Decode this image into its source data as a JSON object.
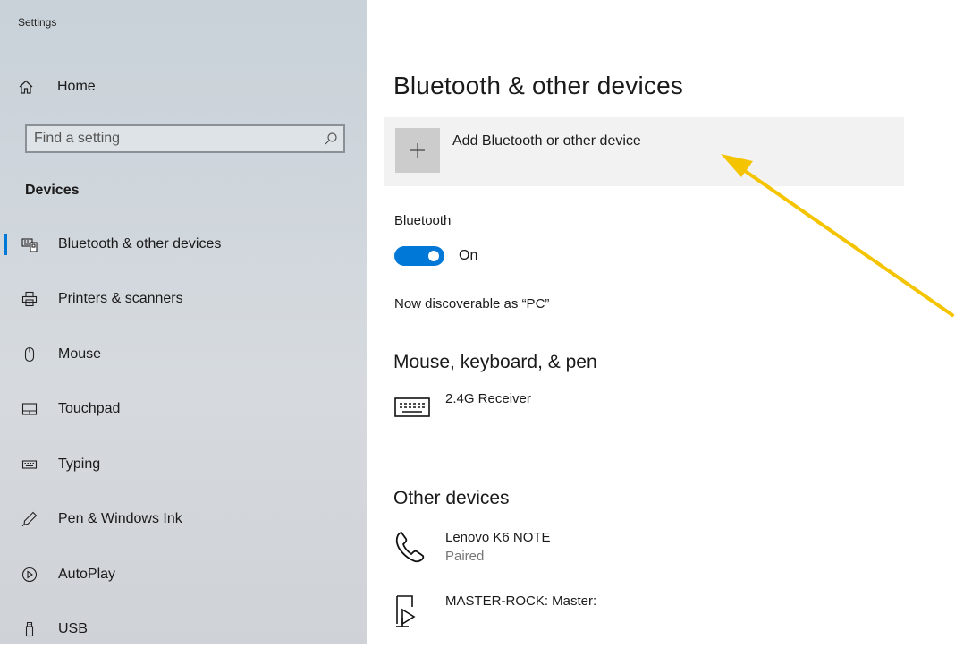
{
  "app": {
    "title": "Settings"
  },
  "sidebar": {
    "home_label": "Home",
    "search": {
      "placeholder": "Find a setting",
      "value": ""
    },
    "section_title": "Devices",
    "items": [
      {
        "label": "Bluetooth & other devices",
        "icon": "bluetooth-devices-icon",
        "active": true
      },
      {
        "label": "Printers & scanners",
        "icon": "printer-icon"
      },
      {
        "label": "Mouse",
        "icon": "mouse-icon"
      },
      {
        "label": "Touchpad",
        "icon": "touchpad-icon"
      },
      {
        "label": "Typing",
        "icon": "keyboard-icon"
      },
      {
        "label": "Pen & Windows Ink",
        "icon": "pen-icon"
      },
      {
        "label": "AutoPlay",
        "icon": "autoplay-icon"
      },
      {
        "label": "USB",
        "icon": "usb-icon"
      }
    ]
  },
  "main": {
    "title": "Bluetooth & other devices",
    "add_device_label": "Add Bluetooth or other device",
    "bluetooth": {
      "label": "Bluetooth",
      "state": "On",
      "enabled": true
    },
    "discoverable_text": "Now discoverable as “PC”",
    "groups": [
      {
        "title": "Mouse, keyboard, & pen",
        "devices": [
          {
            "name": "2.4G Receiver",
            "status": "",
            "icon": "keyboard-icon"
          }
        ]
      },
      {
        "title": "Other devices",
        "devices": [
          {
            "name": "Lenovo K6 NOTE",
            "status": "Paired",
            "icon": "phone-icon"
          },
          {
            "name": "MASTER-ROCK: Master:",
            "status": "",
            "icon": "media-device-icon"
          }
        ]
      }
    ]
  },
  "colors": {
    "accent": "#0078d7",
    "annotation_arrow": "#f5c400"
  }
}
